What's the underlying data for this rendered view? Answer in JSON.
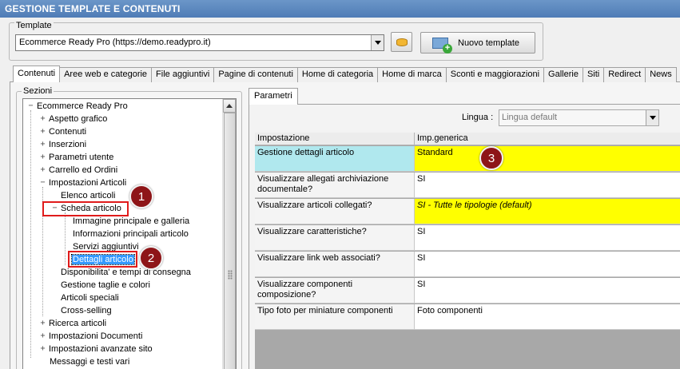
{
  "window": {
    "title": "GESTIONE TEMPLATE E CONTENUTI"
  },
  "template": {
    "legend": "Template",
    "selected": "Ecommerce Ready Pro (https://demo.readypro.it)",
    "new_button": "Nuovo template"
  },
  "tabs": [
    "Contenuti",
    "Aree web e categorie",
    "File aggiuntivi",
    "Pagine di contenuti",
    "Home di categoria",
    "Home di marca",
    "Sconti e maggiorazioni",
    "Gallerie",
    "Siti",
    "Redirect",
    "News"
  ],
  "sections": {
    "legend": "Sezioni",
    "tree": [
      {
        "label": "Ecommerce Ready Pro",
        "toggle": "−"
      },
      {
        "label": "Aspetto grafico",
        "toggle": "+"
      },
      {
        "label": "Contenuti",
        "toggle": "+"
      },
      {
        "label": "Inserzioni",
        "toggle": "+"
      },
      {
        "label": "Parametri utente",
        "toggle": "+"
      },
      {
        "label": "Carrello ed Ordini",
        "toggle": "+"
      },
      {
        "label": "Impostazioni Articoli",
        "toggle": "−"
      },
      {
        "label": "Elenco articoli",
        "toggle": ""
      },
      {
        "label": "Scheda articolo",
        "toggle": "−"
      },
      {
        "label": "Immagine principale e galleria",
        "toggle": ""
      },
      {
        "label": "Informazioni principali articolo",
        "toggle": ""
      },
      {
        "label": "Servizi aggiuntivi",
        "toggle": ""
      },
      {
        "label": "Dettagli articolo",
        "toggle": ""
      },
      {
        "label": "Disponibilita' e tempi di consegna",
        "toggle": ""
      },
      {
        "label": "Gestione taglie e colori",
        "toggle": ""
      },
      {
        "label": "Articoli speciali",
        "toggle": ""
      },
      {
        "label": "Cross-selling",
        "toggle": ""
      },
      {
        "label": "Ricerca articoli",
        "toggle": "+"
      },
      {
        "label": "Impostazioni Documenti",
        "toggle": "+"
      },
      {
        "label": "Impostazioni avanzate sito",
        "toggle": "+"
      },
      {
        "label": "Messaggi e testi vari",
        "toggle": ""
      }
    ]
  },
  "parametri": {
    "tab": "Parametri",
    "lingua_label": "Lingua :",
    "lingua_value": "Lingua default",
    "columns": [
      "Impostazione",
      "Imp.generica"
    ],
    "rows": [
      {
        "setting": "Gestione dettagli articolo",
        "value": "Standard"
      },
      {
        "setting": "Visualizzare allegati archiviazione documentale?",
        "value": "SI"
      },
      {
        "setting": "Visualizzare articoli collegati?",
        "value": "SI - Tutte le tipologie (default)"
      },
      {
        "setting": "Visualizzare caratteristiche?",
        "value": "SI"
      },
      {
        "setting": "Visualizzare link web associati?",
        "value": "SI"
      },
      {
        "setting": "Visualizzare componenti composizione?",
        "value": "SI"
      },
      {
        "setting": "Tipo foto per miniature componenti",
        "value": "Foto componenti"
      }
    ]
  },
  "callouts": [
    "1",
    "2",
    "3"
  ],
  "colors": {
    "highlight_red": "#e01b1b",
    "badge": "#8e1518",
    "yellow": "#ffff00",
    "current_row": "#b0e8ee",
    "selection": "#3399ff"
  }
}
